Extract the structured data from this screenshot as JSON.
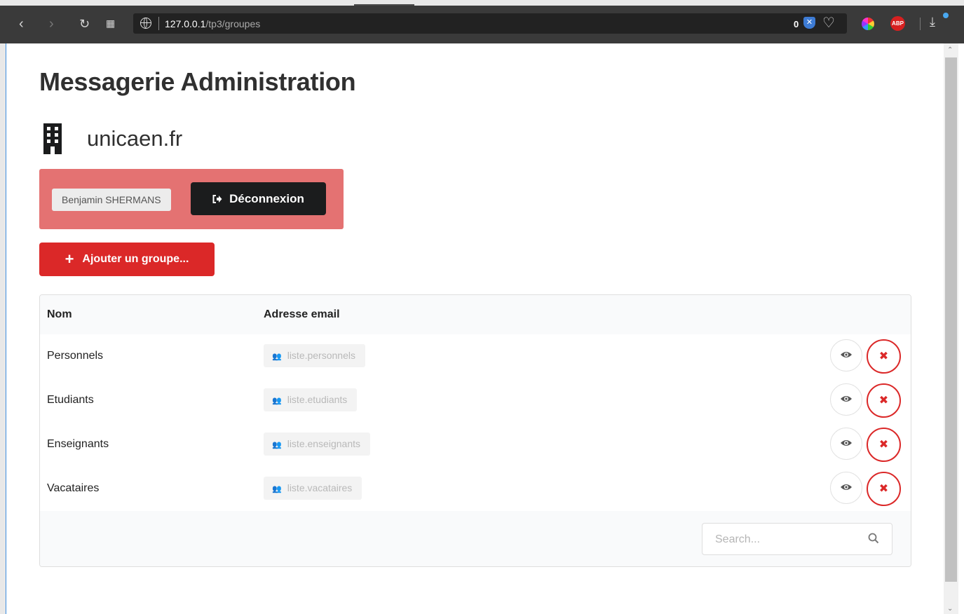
{
  "browser": {
    "url_host": "127.0.0.1",
    "url_path": "/tp3/groupes",
    "shield_count": "0",
    "abp_label": "ABP"
  },
  "page": {
    "title": "Messagerie Administration",
    "domain": "unicaen.fr"
  },
  "user": {
    "name": "Benjamin SHERMANS",
    "logout_label": "Déconnexion"
  },
  "actions": {
    "add_group_label": "Ajouter un groupe..."
  },
  "table": {
    "headers": {
      "name": "Nom",
      "email": "Adresse email"
    },
    "rows": [
      {
        "name": "Personnels",
        "email": "liste.personnels"
      },
      {
        "name": "Etudiants",
        "email": "liste.etudiants"
      },
      {
        "name": "Enseignants",
        "email": "liste.enseignants"
      },
      {
        "name": "Vacataires",
        "email": "liste.vacataires"
      }
    ],
    "search_placeholder": "Search..."
  },
  "colors": {
    "user_box": "#e47272",
    "logout_button": "#1b1c1d",
    "primary_red": "#db2828"
  }
}
